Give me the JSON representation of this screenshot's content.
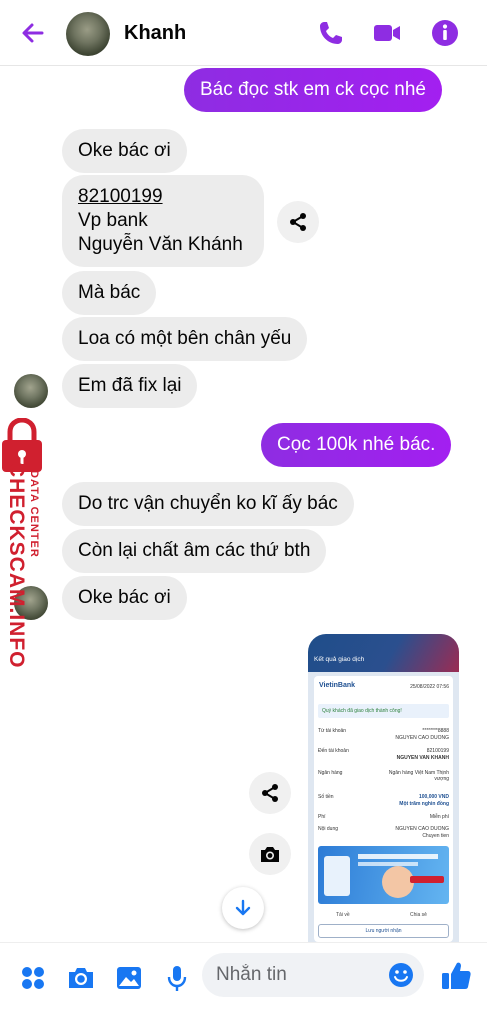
{
  "header": {
    "contact_name": "Khanh",
    "accent_color": "#8e2de2",
    "icons": [
      "back-arrow-icon",
      "phone-icon",
      "video-icon",
      "info-icon"
    ]
  },
  "messages": [
    {
      "direction": "out",
      "text": "Bác đọc stk em ck cọc nhé"
    },
    {
      "direction": "in",
      "text": "Oke bác ơi"
    },
    {
      "direction": "in",
      "lines": [
        "82100199",
        "Vp bank",
        "Nguyễn Văn Khánh"
      ]
    },
    {
      "direction": "in",
      "text": "Mà bác"
    },
    {
      "direction": "in",
      "text": "Loa có một bên chân yếu"
    },
    {
      "direction": "in",
      "text": "Em đã fix lại"
    },
    {
      "direction": "out",
      "text": "Cọc 100k nhé bác."
    },
    {
      "direction": "in",
      "text": "Do trc vận chuyển ko kĩ ấy bác"
    },
    {
      "direction": "in",
      "text": "Còn lại chất âm các thứ bth"
    },
    {
      "direction": "in",
      "text": "Oke bác ơi"
    }
  ],
  "watermark": {
    "top": "DATA CENTER",
    "main": "CHECKSCAM.INFO",
    "color": "#d0202f"
  },
  "receipt": {
    "header_title": "Kết quả giao dịch",
    "bank": "VietinBank",
    "timestamp": "25/08/2022 07:56",
    "success": "Quý khách đã giao dịch thành công!",
    "rows": [
      {
        "label": "Từ tài khoản",
        "value": "********8888",
        "sub": "NGUYEN CAO DUONG"
      },
      {
        "label": "Đến tài khoản",
        "value": "82100199",
        "sub": "NGUYEN VAN KHANH"
      },
      {
        "label": "Ngân hàng",
        "value": "Ngân hàng Việt Nam Thịnh vượng"
      },
      {
        "label": "Số tiền",
        "value": "100,000 VND",
        "sub": "Một trăm nghìn đồng"
      },
      {
        "label": "Phí",
        "value": "Miễn phí"
      },
      {
        "label": "Nội dung",
        "value": "NGUYEN CAO DUONG",
        "sub": "Chuyen tien"
      }
    ],
    "save_label": "Tải về",
    "share_label": "Chia sẻ",
    "save_receiver_label": "Lưu người nhận"
  },
  "composer": {
    "placeholder": "Nhắn tin"
  },
  "bottom_icons": [
    "apps-icon",
    "camera-icon",
    "gallery-icon",
    "microphone-icon",
    "emoji-icon",
    "like-icon"
  ]
}
